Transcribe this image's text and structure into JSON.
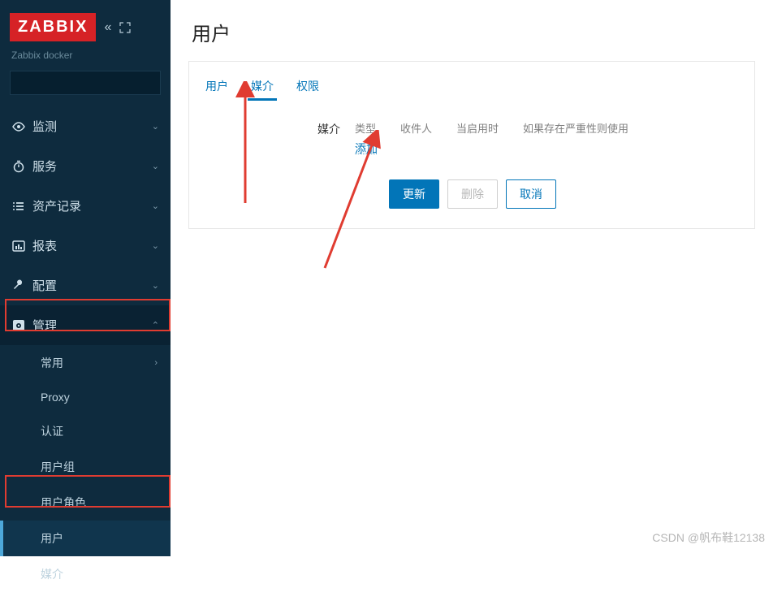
{
  "brand": {
    "logo": "ZABBIX",
    "subtitle": "Zabbix docker"
  },
  "search": {
    "placeholder": ""
  },
  "nav": {
    "items": [
      {
        "label": "监测"
      },
      {
        "label": "服务"
      },
      {
        "label": "资产记录"
      },
      {
        "label": "报表"
      },
      {
        "label": "配置"
      },
      {
        "label": "管理"
      }
    ],
    "admin_sub": [
      {
        "label": "常用"
      },
      {
        "label": "Proxy"
      },
      {
        "label": "认证"
      },
      {
        "label": "用户组"
      },
      {
        "label": "用户角色"
      },
      {
        "label": "用户"
      },
      {
        "label": "媒介"
      }
    ]
  },
  "page": {
    "title": "用户",
    "tabs": {
      "user": "用户",
      "media": "媒介",
      "perm": "权限"
    },
    "media": {
      "label": "媒介",
      "headers": {
        "type": "类型",
        "recipient": "收件人",
        "when_active": "当启用时",
        "severity": "如果存在严重性则使用"
      },
      "add": "添加"
    },
    "buttons": {
      "update": "更新",
      "delete": "删除",
      "cancel": "取消"
    }
  },
  "watermark": "CSDN @帆布鞋12138"
}
